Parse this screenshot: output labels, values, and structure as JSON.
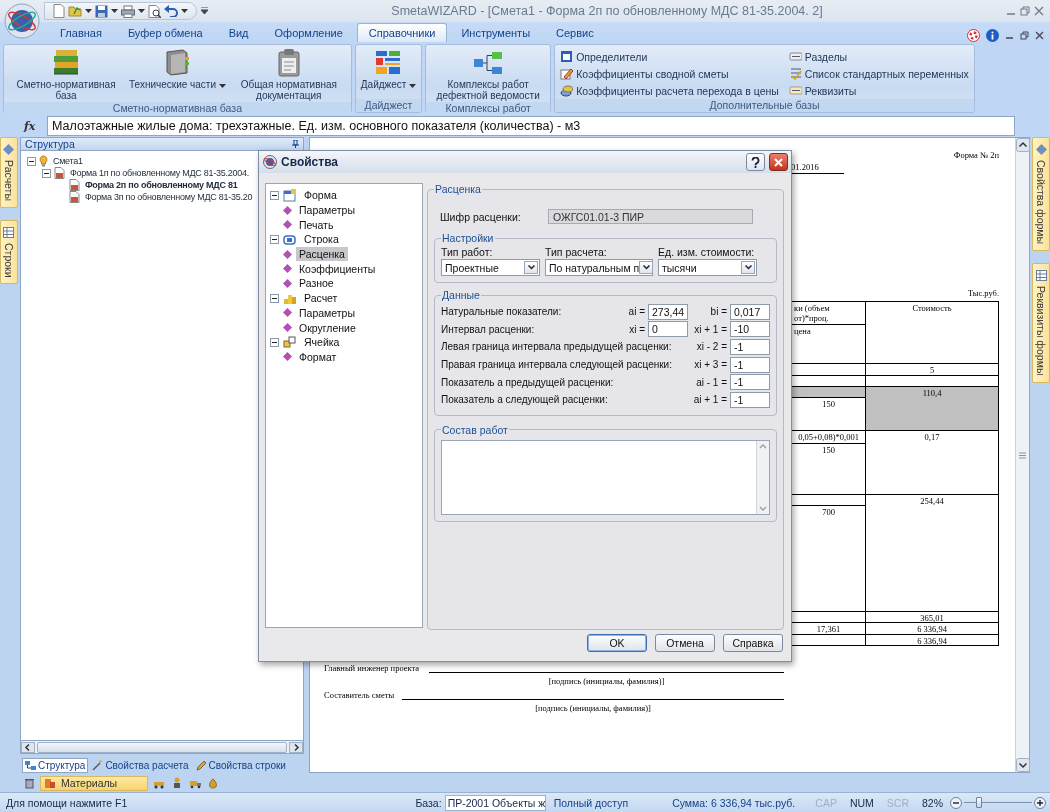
{
  "window": {
    "title": "SmetaWIZARD - [Смета1 - Форма 2п по обновленному МДС 81-35.2004. 2]"
  },
  "ribbon": {
    "tabs": [
      {
        "label": "Главная",
        "selected": false
      },
      {
        "label": "Буфер обмена",
        "selected": false
      },
      {
        "label": "Вид",
        "selected": false
      },
      {
        "label": "Оформление",
        "selected": false
      },
      {
        "label": "Справочники",
        "selected": true
      },
      {
        "label": "Инструменты",
        "selected": false
      },
      {
        "label": "Сервис",
        "selected": false
      }
    ],
    "groups": [
      {
        "label": "Сметно-нормативная база",
        "kind": "large",
        "buttons": [
          {
            "label": "Сметно-нормативная база",
            "dropdown": false
          },
          {
            "label": "Технические части",
            "dropdown": true
          },
          {
            "label": "Общая нормативная документация",
            "dropdown": false
          }
        ]
      },
      {
        "label": "Дайджест",
        "kind": "large",
        "buttons": [
          {
            "label": "Дайджест",
            "dropdown": true
          }
        ]
      },
      {
        "label": "Комплексы работ",
        "kind": "large",
        "buttons": [
          {
            "label": "Комплексы работ дефектной ведомости",
            "dropdown": false
          }
        ]
      },
      {
        "label": "Дополнительные базы",
        "kind": "list",
        "items": [
          "Определители",
          "Коэффициенты сводной сметы",
          "Коэффициенты расчета перехода в цены",
          "Разделы",
          "Список стандартных переменных",
          "Реквизиты"
        ]
      }
    ]
  },
  "formula_bar": {
    "icon": "fx",
    "value": "Малоэтажные жилые дома: трехэтажные. Ед. изм. основного показателя (количества) - м3"
  },
  "left_strip": {
    "tabs": [
      "Расчеты",
      "Строки"
    ]
  },
  "right_strip": {
    "tabs": [
      "Свойства формы",
      "Реквизиты формы"
    ]
  },
  "structure": {
    "title": "Структура",
    "tree": [
      {
        "label": "Смета1",
        "selected": false,
        "expanded": true,
        "children": [
          {
            "label": "Форма 1п по обновленному МДС 81-35.2004.",
            "selected": false,
            "expanded": true,
            "children": [
              {
                "label": "Форма 2п по обновленному МДС 81",
                "selected": true
              },
              {
                "label": "Форма 3п по обновленному МДС 81-35.20",
                "selected": false
              }
            ]
          }
        ]
      }
    ],
    "tabs": [
      {
        "label": "Структура",
        "selected": true
      },
      {
        "label": "Свойства расчета",
        "selected": false
      },
      {
        "label": "Свойства строки",
        "selected": false
      }
    ],
    "toolbar_label": "Материалы"
  },
  "document": {
    "form_number": "Форма № 2п",
    "date": "01.2016",
    "units": "Тыс.руб.",
    "rows": [
      {
        "left": [
          {
            "text": "ки (объем от)*проц.",
            "shaded": false
          },
          {
            "text": "цена",
            "shaded": false
          }
        ],
        "right": {
          "text": "Стоимость",
          "shaded": false
        }
      },
      {
        "left": [
          {
            "shaded": false
          }
        ],
        "right": {
          "text": "5",
          "shaded": false
        }
      },
      {
        "left": [
          {
            "shaded": false
          }
        ],
        "right": {
          "shaded": false
        }
      },
      {
        "left": [
          {
            "shaded": true
          },
          {
            "text": "150",
            "shaded": false
          }
        ],
        "right": {
          "text": "110,4",
          "shaded": true
        }
      },
      {
        "left": [
          {
            "text": "0,05+0,08)*0,001",
            "shaded": false
          },
          {
            "text": "150",
            "shaded": false
          }
        ],
        "right": {
          "text": "0,17",
          "shaded": false
        }
      },
      {
        "left": [
          {
            "shaded": false
          },
          {
            "text": "700",
            "shaded": false
          }
        ],
        "right": {
          "text": "254,44",
          "shaded": false
        }
      },
      {
        "left": [
          {
            "shaded": false
          }
        ],
        "right": {
          "text": "365,01",
          "shaded": false
        }
      },
      {
        "left": [
          {
            "text": "17,361",
            "shaded": false
          }
        ],
        "right": {
          "text": "6 336,94",
          "shaded": false
        }
      },
      {
        "left": [
          {
            "shaded": false
          }
        ],
        "right": {
          "text": "6 336,94",
          "shaded": false
        }
      }
    ],
    "signatures": [
      {
        "label": "Главный инженер проекта",
        "caption": "[подпись (инициалы, фамилия)]"
      },
      {
        "label": "Составитель сметы",
        "caption": "[подпись (инициалы, фамилия)]"
      }
    ]
  },
  "dialog": {
    "title": "Свойства",
    "tree": [
      {
        "label": "Форма",
        "expanded": true,
        "children": [
          {
            "label": "Параметры",
            "selected": false
          },
          {
            "label": "Печать",
            "selected": false
          }
        ]
      },
      {
        "label": "Строка",
        "expanded": true,
        "children": [
          {
            "label": "Расценка",
            "selected": true
          },
          {
            "label": "Коэффициенты",
            "selected": false
          },
          {
            "label": "Разное",
            "selected": false
          }
        ]
      },
      {
        "label": "Расчет",
        "expanded": true,
        "children": [
          {
            "label": "Параметры",
            "selected": false
          },
          {
            "label": "Округление",
            "selected": false
          }
        ]
      },
      {
        "label": "Ячейка",
        "expanded": true,
        "children": [
          {
            "label": "Формат",
            "selected": false
          }
        ]
      }
    ],
    "section_title": "Расценка",
    "code_label": "Шифр расценки:",
    "code_value": "ОЖГС01.01-3 ПИР",
    "settings": {
      "title": "Настройки",
      "combos": [
        {
          "label": "Тип работ:",
          "value": "Проектные"
        },
        {
          "label": "Тип расчета:",
          "value": "По натуральным п"
        },
        {
          "label": "Ед. изм. стоимости:",
          "value": "тысячи"
        }
      ]
    },
    "data": {
      "title": "Данные",
      "rows": [
        {
          "label": "Натуральные показатели:",
          "fields": [
            {
              "prefix": "ai =",
              "value": "273,44"
            },
            {
              "prefix": "bi =",
              "value": "0,017"
            }
          ]
        },
        {
          "label": "Интервал расценки:",
          "fields": [
            {
              "prefix": "xi =",
              "value": "0"
            },
            {
              "prefix": "xi + 1 =",
              "value": "-10"
            }
          ]
        },
        {
          "label": "Левая граница интервала предыдущей расценки:",
          "fields": [
            {
              "prefix": "xi - 2 =",
              "value": "-1"
            }
          ]
        },
        {
          "label": "Правая граница интервала следующей расценки:",
          "fields": [
            {
              "prefix": "xi + 3 =",
              "value": "-1"
            }
          ]
        },
        {
          "label": "Показатель а предыдущей расценки:",
          "fields": [
            {
              "prefix": "ai - 1 =",
              "value": "-1"
            }
          ]
        },
        {
          "label": "Показатель а следующей расценки:",
          "fields": [
            {
              "prefix": "ai + 1 =",
              "value": "-1"
            }
          ]
        }
      ]
    },
    "works_title": "Состав работ",
    "buttons": [
      {
        "label": "OK",
        "default": true
      },
      {
        "label": "Отмена",
        "default": false
      },
      {
        "label": "Справка",
        "default": false
      }
    ]
  },
  "status_bar": {
    "help": "Для помощи нажмите F1",
    "base_label": "База:",
    "base_value": "ПР-2001 Объекты ж",
    "access": "Полный доступ",
    "sum": "Сумма: 6 336,94 тыс.руб.",
    "indicators": [
      {
        "label": "CAP",
        "on": false
      },
      {
        "label": "NUM",
        "on": true
      },
      {
        "label": "SCR",
        "on": false
      }
    ],
    "zoom": {
      "reading": "82%",
      "level": 0.22
    }
  }
}
